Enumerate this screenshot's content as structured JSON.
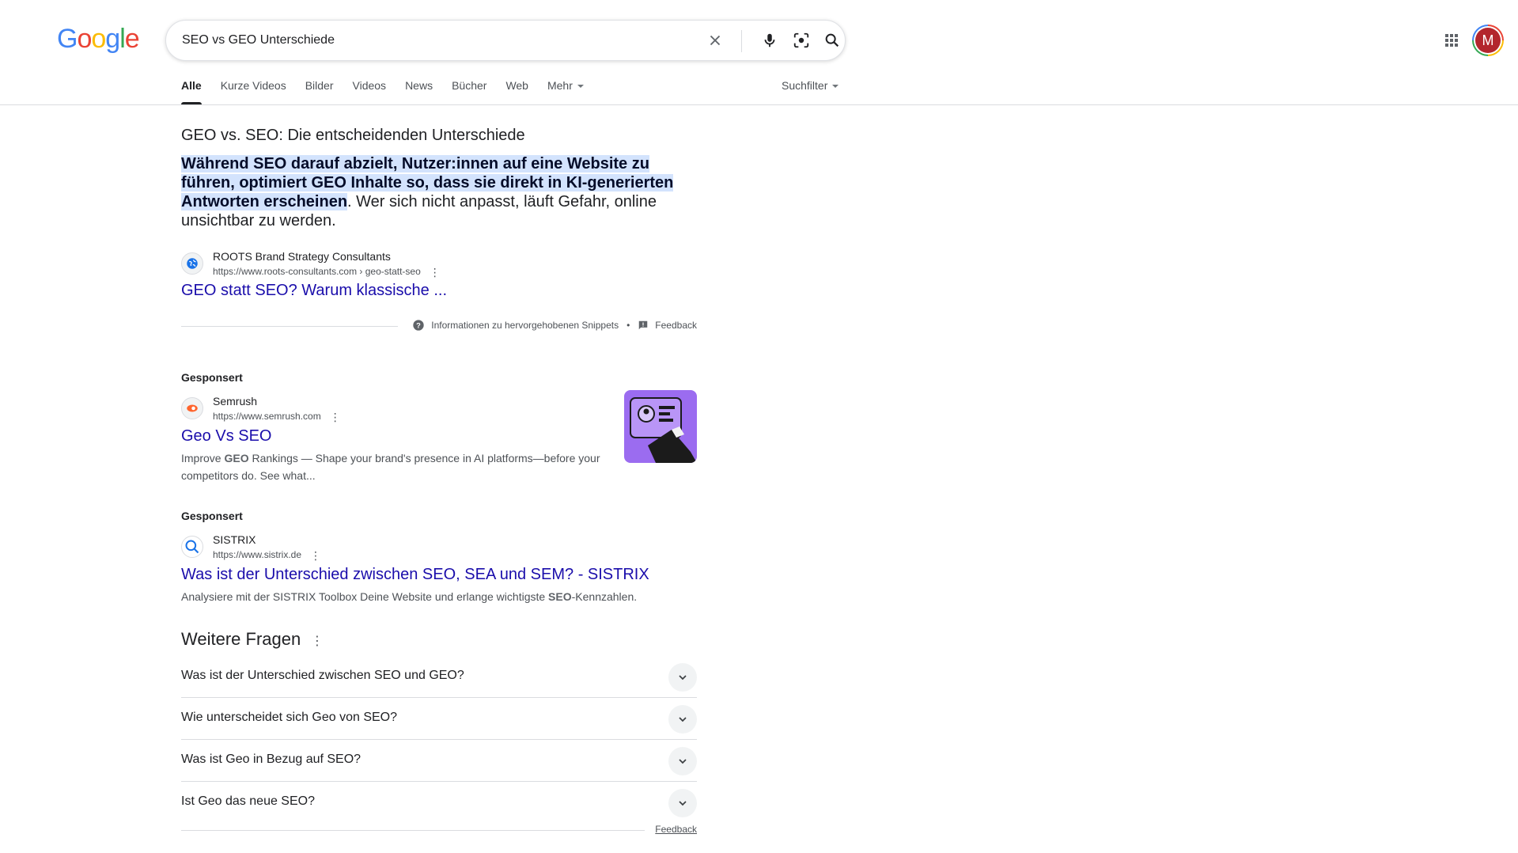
{
  "header": {
    "logo_letters": [
      "G",
      "o",
      "o",
      "g",
      "l",
      "e"
    ],
    "search_query": "SEO vs GEO Unterschiede",
    "avatar_initial": "M"
  },
  "tabs": [
    {
      "label": "Alle",
      "active": true
    },
    {
      "label": "Kurze Videos"
    },
    {
      "label": "Bilder"
    },
    {
      "label": "Videos"
    },
    {
      "label": "News"
    },
    {
      "label": "Bücher"
    },
    {
      "label": "Web"
    },
    {
      "label": "Mehr",
      "dropdown": true
    }
  ],
  "suchfilter_label": "Suchfilter",
  "featured_snippet": {
    "title": "GEO vs. SEO: Die entscheidenden Unterschiede",
    "highlight": "Während SEO darauf abzielt, Nutzer:innen auf eine Website zu führen, optimiert GEO Inhalte so, dass sie direkt in KI-generierten Antworten erscheinen",
    "rest": ". Wer sich nicht anpasst, läuft Gefahr, online unsichtbar zu werden.",
    "source_name": "ROOTS Brand Strategy Consultants",
    "source_url": "https://www.roots-consultants.com › geo-statt-seo",
    "link_title": "GEO statt SEO? Warum klassische ...",
    "about_label": "Informationen zu hervorgehobenen Snippets",
    "separator": "•",
    "feedback_label": "Feedback"
  },
  "ads": [
    {
      "sponsored_label": "Gesponsert",
      "name": "Semrush",
      "url": "https://www.semrush.com",
      "title": "Geo Vs SEO",
      "desc_parts": [
        "Improve ",
        "GEO",
        " Rankings — Shape your brand's presence in AI platforms—before your competitors do. See what..."
      ]
    },
    {
      "sponsored_label": "Gesponsert",
      "name": "SISTRIX",
      "url": "https://www.sistrix.de",
      "title": "Was ist der Unterschied zwischen SEO, SEA und SEM? - SISTRIX",
      "desc_parts": [
        "Analysiere mit der SISTRIX Toolbox Deine Website und erlange wichtigste ",
        "SEO",
        "-Kennzahlen."
      ]
    }
  ],
  "weitere_fragen": {
    "title": "Weitere Fragen",
    "questions": [
      "Was ist der Unterschied zwischen SEO und GEO?",
      "Wie unterscheidet sich Geo von SEO?",
      "Was ist Geo in Bezug auf SEO?",
      "Ist Geo das neue SEO?"
    ],
    "feedback_label": "Feedback"
  },
  "colors": {
    "link": "#1a0dab",
    "highlight_bg": "#d3e3fd",
    "avatar_bg": "#b3262d",
    "semrush_thumb": "#9b6cf0"
  }
}
